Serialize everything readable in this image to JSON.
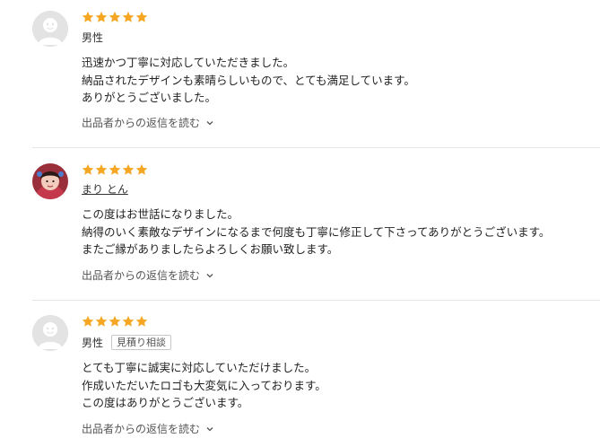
{
  "reviews": [
    {
      "rating": 5,
      "avatar": "default-user-icon",
      "name": "男性",
      "badge": "",
      "lines": [
        "迅速かつ丁寧に対応していただきました。",
        "納品されたデザインも素晴らしいもので、とても満足しています。",
        "ありがとうございました。"
      ],
      "reply_label": "出品者からの返信を読む"
    },
    {
      "rating": 5,
      "avatar": "user-photo-icon",
      "name": "まり とん",
      "badge": "",
      "lines": [
        "この度はお世話になりました。",
        "納得のいく素敵なデザインになるまで何度も丁寧に修正して下さってありがとうございます。",
        "またご縁がありましたらよろしくお願い致します。"
      ],
      "reply_label": "出品者からの返信を読む"
    },
    {
      "rating": 5,
      "avatar": "default-user-icon",
      "name": "男性",
      "badge": "見積り相談",
      "lines": [
        "とても丁寧に誠実に対応していただけました。",
        "作成いただいたロゴも大変気に入っております。",
        "この度はありがとうございます。"
      ],
      "reply_label": "出品者からの返信を読む"
    }
  ],
  "colors": {
    "star": "#f5a623",
    "text": "#222222",
    "muted": "#555555",
    "divider": "#e6e6e6"
  }
}
